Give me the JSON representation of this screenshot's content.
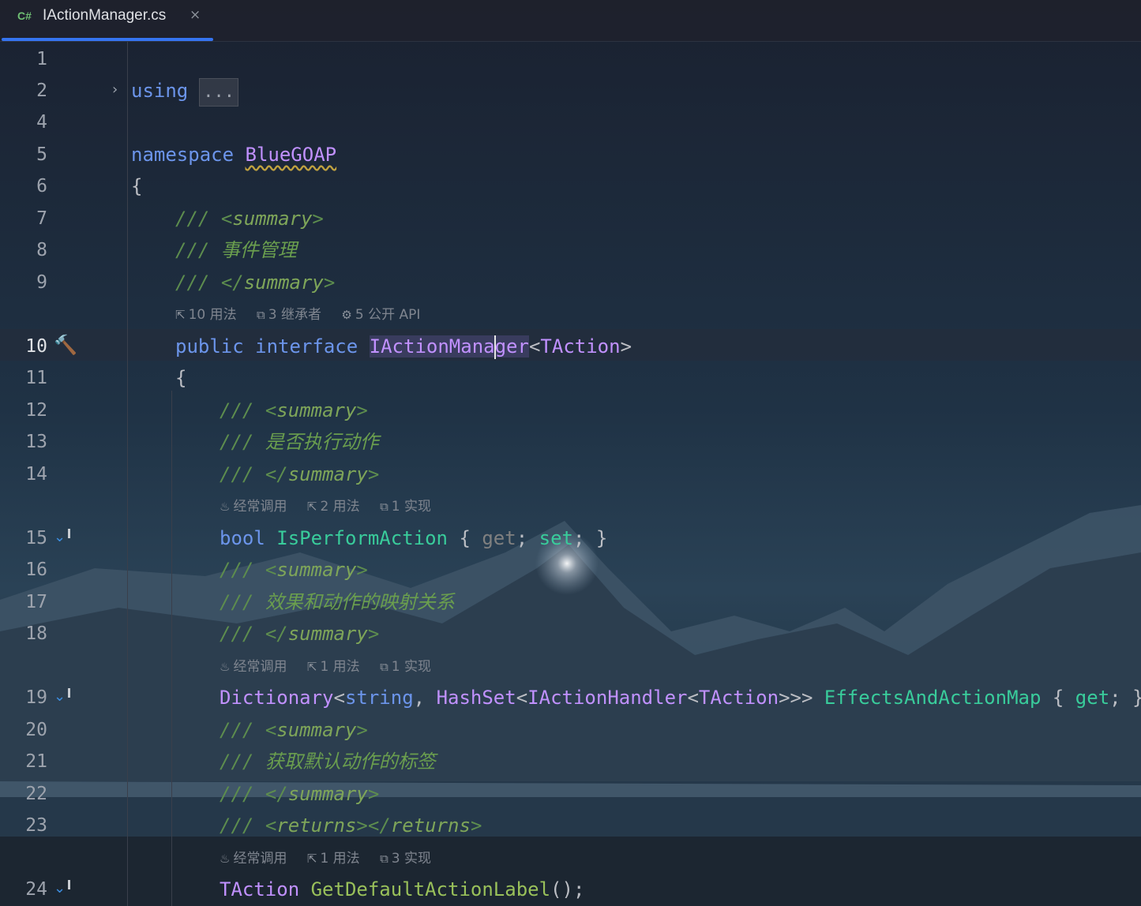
{
  "tab": {
    "lang": "C#",
    "title": "IActionManager.cs",
    "close": "×"
  },
  "lines": {
    "l1": "1",
    "l2": "2",
    "l4": "4",
    "l5": "5",
    "l6": "6",
    "l7": "7",
    "l8": "8",
    "l9": "9",
    "l10": "10",
    "l11": "11",
    "l12": "12",
    "l13": "13",
    "l14": "14",
    "l15": "15",
    "l16": "16",
    "l17": "17",
    "l18": "18",
    "l19": "19",
    "l20": "20",
    "l21": "21",
    "l22": "22",
    "l23": "23",
    "l24": "24"
  },
  "code": {
    "using": "using",
    "using_fold": "...",
    "namespace_kw": "namespace",
    "namespace_name": "BlueGOAP",
    "brace_open": "{",
    "doc_slash": "///",
    "summary_open": "<summary>",
    "summary_close": "</summary>",
    "summary_open_lt": "<",
    "summary_word": "summary",
    "gt": ">",
    "close_lt": "</",
    "returns_word": "returns",
    "doc_class": "事件管理",
    "public_kw": "public",
    "interface_kw": "interface",
    "iface_name_a": "IActionMana",
    "iface_name_b": "ger",
    "generic_open": "<",
    "taction": "TAction",
    "generic_close": ">",
    "doc_perform": "是否执行动作",
    "bool_kw": "bool",
    "prop_perform": "IsPerformAction",
    "brace_l": "{",
    "brace_r": "}",
    "get_kw": "get",
    "set_kw": "set",
    "semi": ";",
    "doc_map": "效果和动作的映射关系",
    "dictionary": "Dictionary",
    "string_kw": "string",
    "comma": ",",
    "hashset": "HashSet",
    "iactionhandler": "IActionHandler",
    "triple_gt": ">>>",
    "prop_map": "EffectsAndActionMap",
    "doc_label": "获取默认动作的标签",
    "method_label": "GetDefaultActionLabel",
    "parens": "()"
  },
  "hints": {
    "class": {
      "usages": "10 用法",
      "inheritors": "3 继承者",
      "api": "5 公开 API"
    },
    "perform": {
      "frequent": "经常调用",
      "usages": "2 用法",
      "impl": "1 实现"
    },
    "map": {
      "frequent": "经常调用",
      "usages": "1 用法",
      "impl": "1 实现"
    },
    "label": {
      "frequent": "经常调用",
      "usages": "1 用法",
      "impl": "3 实现"
    }
  },
  "icons": {
    "usages": "usages-icon",
    "inheritors": "inheritors-icon",
    "api": "api-icon",
    "frequent": "fire-icon",
    "impl": "implementation-icon",
    "hammer": "hammer-icon",
    "gutter_impl": "implemented-arrow-icon"
  },
  "colors": {
    "keyword": "#6c95eb",
    "type": "#c191ff",
    "identifier": "#39cc9b",
    "doc_comment": "#5d8d4e",
    "accent_tab": "#3574f0"
  }
}
